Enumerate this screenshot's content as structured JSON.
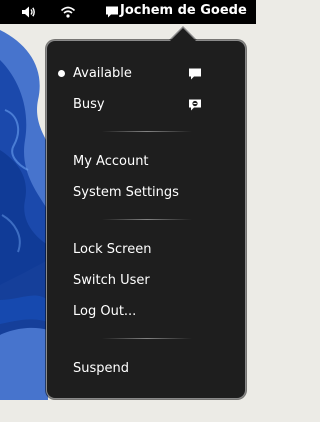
{
  "topbar": {
    "volume_icon": "speaker-volume-icon",
    "network_icon": "wifi-icon",
    "user_icon": "chat-bubble-icon",
    "user_name": "Jochem de Goede"
  },
  "menu": {
    "status_items": [
      {
        "label": "Available",
        "selected": true,
        "icon": "chat-bubble-icon"
      },
      {
        "label": "Busy",
        "selected": false,
        "icon": "busy-chat-icon"
      }
    ],
    "account_items": [
      {
        "label": "My Account"
      },
      {
        "label": "System Settings"
      }
    ],
    "session_items": [
      {
        "label": "Lock Screen"
      },
      {
        "label": "Switch User"
      },
      {
        "label": "Log Out..."
      }
    ],
    "power_items": [
      {
        "label": "Suspend"
      }
    ]
  },
  "colors": {
    "panel": "#000000",
    "menu_bg": "#1e1e1e",
    "menu_border": "#8a8a8a",
    "text": "#ffffff",
    "wallpaper_accent": "#1f55c4"
  }
}
